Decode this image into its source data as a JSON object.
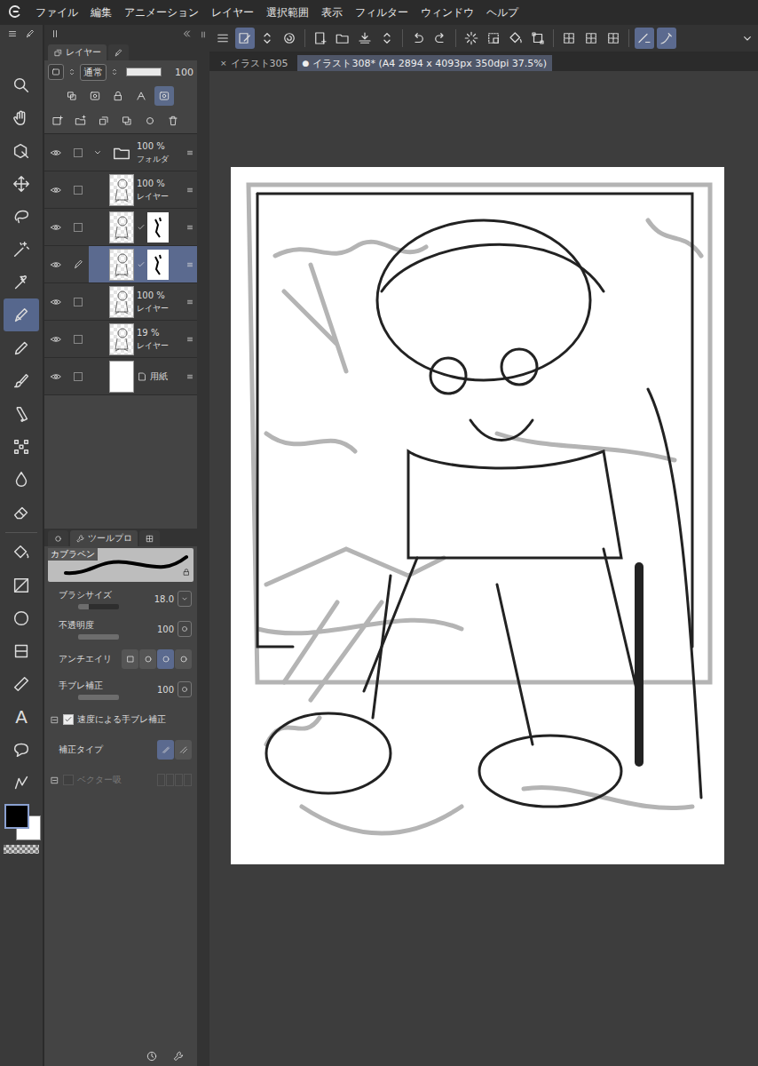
{
  "menu": [
    "ファイル",
    "編集",
    "アニメーション",
    "レイヤー",
    "選択範囲",
    "表示",
    "フィルター",
    "ウィンドウ",
    "ヘルプ"
  ],
  "tools": [
    {
      "selected": false
    },
    {
      "selected": false
    },
    {
      "selected": false
    },
    {
      "selected": false
    },
    {
      "selected": false
    },
    {
      "selected": false
    },
    {
      "selected": false
    },
    {
      "selected": true
    },
    {
      "selected": false
    },
    {
      "selected": false
    },
    {
      "selected": false
    },
    {
      "selected": false
    },
    {
      "selected": false
    },
    {
      "selected": false
    },
    {
      "selected": false
    },
    {
      "selected": false
    },
    {
      "selected": false
    },
    {
      "selected": false
    },
    {
      "selected": false
    },
    {
      "selected": false,
      "label": "A"
    },
    {
      "selected": false
    },
    {
      "selected": false
    }
  ],
  "main_color": "#000000",
  "sub_color": "#ffffff",
  "commands": [
    {
      "selected": false
    },
    {
      "selected": true
    },
    {
      "selected": false
    },
    {
      "selected": false
    },
    {
      "selected": false
    },
    {
      "selected": false
    },
    {
      "selected": false
    },
    {
      "selected": false
    },
    {
      "selected": false
    },
    {
      "selected": false
    },
    {
      "selected": false
    },
    {
      "selected": false
    },
    {
      "selected": false
    },
    {
      "selected": false
    },
    {
      "selected": false
    },
    {
      "selected": false
    },
    {
      "selected": false
    },
    {
      "selected": true
    },
    {
      "selected": true
    }
  ],
  "tabs": [
    {
      "mark": "×",
      "label": "イラスト305",
      "selected": false
    },
    {
      "mark": "●",
      "label": "イラスト308* (A4 2894 x 4093px 350dpi 37.5%)",
      "selected": true
    }
  ],
  "layer_panel": {
    "tab": "レイヤー",
    "blend": "通常",
    "opacity": "100",
    "opacity_level": 1,
    "toggles": [
      {
        "selected": false
      },
      {
        "selected": false
      },
      {
        "selected": false
      },
      {
        "selected": false
      },
      {
        "selected": true
      }
    ],
    "layers": [
      {
        "kind": "folder",
        "opacity": "100 %",
        "name": "フォルダ",
        "visible": true,
        "expanded": true,
        "editing": false,
        "selected": false,
        "mask": false
      },
      {
        "kind": "layer",
        "opacity": "100 %",
        "name": "レイヤー",
        "visible": true,
        "editing": false,
        "selected": false,
        "mask": false
      },
      {
        "kind": "layer",
        "visible": true,
        "editing": false,
        "selected": false,
        "mask": true
      },
      {
        "kind": "layer",
        "visible": true,
        "editing": true,
        "selected": true,
        "mask": true
      },
      {
        "kind": "layer",
        "opacity": "100 %",
        "name": "レイヤー",
        "visible": true,
        "editing": false,
        "selected": false,
        "mask": false
      },
      {
        "kind": "layer",
        "opacity": "19 %",
        "name": "レイヤー",
        "visible": true,
        "editing": false,
        "selected": false,
        "mask": false
      },
      {
        "kind": "paper",
        "name": "用紙",
        "visible": true,
        "editing": false,
        "selected": false,
        "mask": false
      }
    ]
  },
  "tool_property": {
    "tab": "ツールプロ",
    "brush": "カブラペン",
    "props": [
      {
        "kind": "slider",
        "label": "ブラシサイズ",
        "value": "18.0",
        "level": 0.25
      },
      {
        "kind": "slider",
        "label": "不透明度",
        "value": "100",
        "level": 1
      },
      {
        "kind": "toggles",
        "label": "アンチエイリ",
        "options": [
          {
            "selected": false
          },
          {
            "selected": false
          },
          {
            "selected": true
          },
          {
            "selected": false
          }
        ]
      },
      {
        "kind": "slider",
        "label": "手ブレ補正",
        "value": "100",
        "level": 1
      },
      {
        "kind": "checkbox",
        "label": "速度による手ブレ補正",
        "checked": true,
        "disabled": false
      },
      {
        "kind": "toggles",
        "label": "補正タイプ",
        "options": [
          {
            "selected": true
          },
          {
            "selected": false
          }
        ]
      },
      {
        "kind": "checkbox",
        "label": "ベクター吸",
        "checked": false,
        "disabled": true
      }
    ]
  }
}
